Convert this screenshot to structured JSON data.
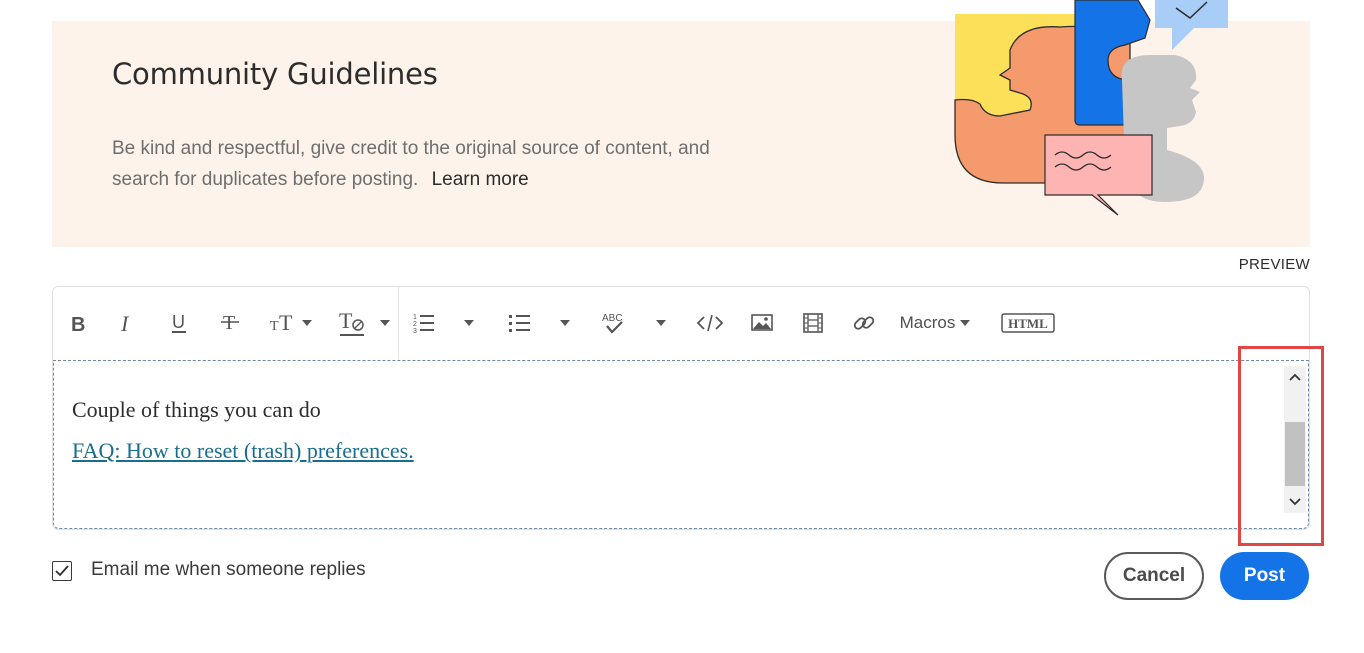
{
  "banner": {
    "title": "Community Guidelines",
    "text": "Be kind and respectful, give credit to the original source of content, and search for duplicates before posting.",
    "learn_more": "Learn more"
  },
  "preview_label": "PREVIEW",
  "toolbar": {
    "macros_label": "Macros",
    "buttons": [
      "bold-icon",
      "italic-icon",
      "underline-icon",
      "strikethrough-icon",
      "font-size-icon",
      "text-style-icon",
      "numbered-list-icon",
      "bulleted-list-icon",
      "spell-check-icon",
      "code-icon",
      "image-icon",
      "video-icon",
      "link-icon",
      "html-icon"
    ]
  },
  "editor": {
    "line1": "Couple of things you can do",
    "link_text": "FAQ: How to reset (trash) preferences."
  },
  "footer": {
    "email_label": "Email me when someone replies",
    "email_checked": true,
    "cancel_label": "Cancel",
    "post_label": "Post"
  },
  "colors": {
    "banner_bg": "#fdf3ea",
    "link": "#1a6d8e",
    "primary": "#1473e6",
    "highlight": "#e04646"
  }
}
